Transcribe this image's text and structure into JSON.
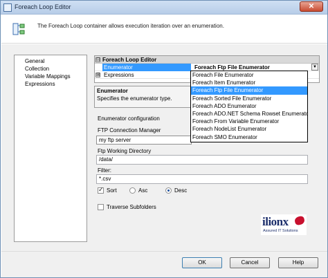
{
  "window": {
    "title": "Foreach Loop Editor",
    "close_symbol": "✕"
  },
  "header": {
    "description": "The Foreach Loop container allows execution iteration over an enumeration."
  },
  "nav": {
    "items": [
      "General",
      "Collection",
      "Variable Mappings",
      "Expressions"
    ]
  },
  "property_grid": {
    "section_title": "Foreach Loop Editor",
    "section_expander": "⊟",
    "rows": [
      {
        "name": "Enumerator",
        "value": "Foreach Ftp File Enumerator"
      },
      {
        "name": "Expressions",
        "value": ""
      }
    ],
    "expressions_expander": "⊞",
    "dropdown_arrow": "▼"
  },
  "dropdown": {
    "options": [
      "Foreach File Enumerator",
      "Foreach Item Enumerator",
      "Foreach Ftp File Enumerator",
      "Foreach Sorted File Enumerator",
      "Foreach ADO Enumerator",
      "Foreach ADO.NET Schema Rowset Enumerator",
      "Foreach From Variable Enumerator",
      "Foreach NodeList Enumerator",
      "Foreach SMO Enumerator"
    ],
    "highlighted_index": 2
  },
  "description_box": {
    "title": "Enumerator",
    "text": "Specifies the enumerator type."
  },
  "config": {
    "section_label": "Enumerator configuration",
    "ftp_connection_label": "FTP Connection Manager",
    "ftp_connection_value": "my ftp server",
    "working_dir_label": "Ftp Working Directory",
    "working_dir_value": "/data/",
    "filter_label": "Filter:",
    "filter_value": "*.csv",
    "sort_label": "Sort",
    "sort_checked": true,
    "asc_label": "Asc",
    "desc_label": "Desc",
    "sort_direction": "Desc",
    "traverse_label": "Traverse Subfolders",
    "traverse_checked": false
  },
  "logo": {
    "name": "ilionx",
    "tagline": "Assured IT Solutions"
  },
  "footer": {
    "ok_label": "OK",
    "cancel_label": "Cancel",
    "help_label": "Help"
  }
}
